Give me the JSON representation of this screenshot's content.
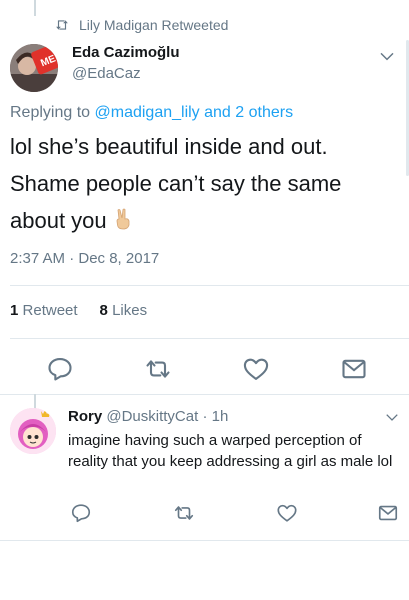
{
  "retweet_header": {
    "text": "Lily Madigan Retweeted"
  },
  "main_tweet": {
    "author_name": "Eda Cazimoğlu",
    "author_handle": "@EdaCaz",
    "avatar_text": "ME",
    "replying_prefix": "Replying to ",
    "replying_mention": "@madigan_lily",
    "replying_suffix": " and 2 others",
    "text": "lol she’s beautiful inside and out. Shame people can’t say the same about you",
    "emoji": "victory-hand-emoji",
    "timestamp": "2:37 AM · Dec 8, 2017",
    "retweets_count": "1",
    "retweets_label": "Retweet",
    "likes_count": "8",
    "likes_label": "Likes"
  },
  "reply": {
    "author_name": "Rory",
    "author_handle": "@DuskittyCat",
    "separator": "·",
    "time": "1h",
    "text": "imagine having such a warped perception of reality that you keep addressing a girl as male lol"
  },
  "colors": {
    "link": "#1da1f2",
    "muted": "#657786",
    "text": "#14171a",
    "divider": "#e1e8ed"
  },
  "icons": [
    "retweet-icon",
    "chevron-down-icon",
    "reply-icon",
    "heart-icon",
    "message-icon"
  ]
}
